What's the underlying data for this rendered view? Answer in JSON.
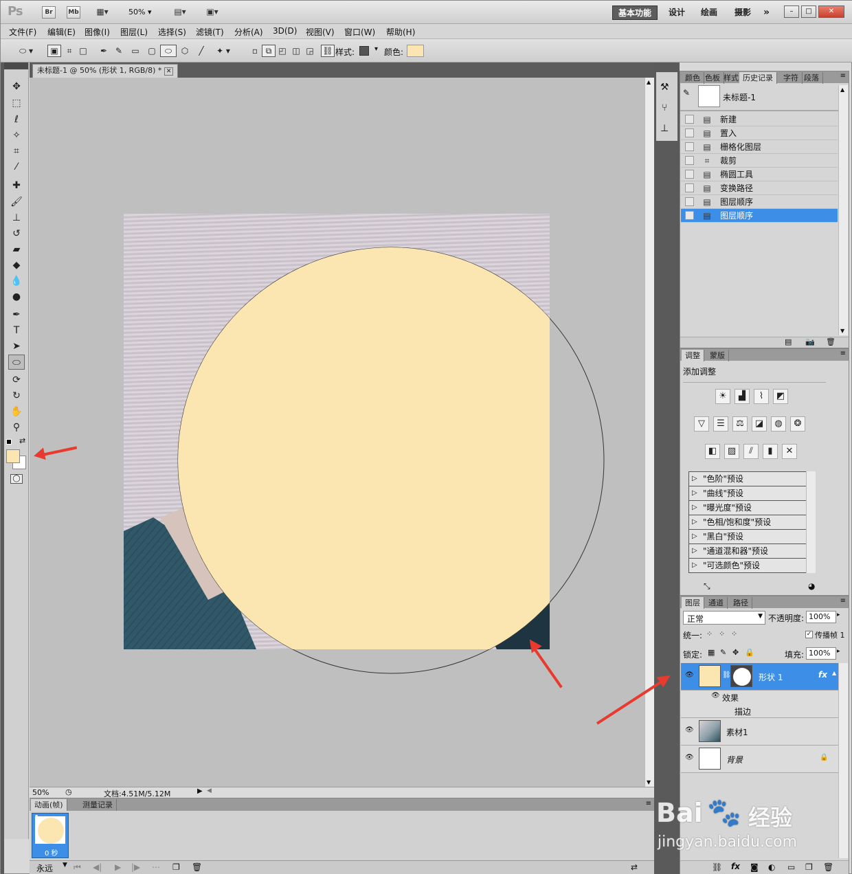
{
  "app": {
    "logo": "Ps",
    "zoom_select": "50%"
  },
  "appbar": {
    "br": "Br",
    "mb": "Mb",
    "workspaces": [
      "基本功能",
      "设计",
      "绘画",
      "摄影"
    ],
    "more": "»"
  },
  "menubar": {
    "items": [
      "文件(F)",
      "编辑(E)",
      "图像(I)",
      "图层(L)",
      "选择(S)",
      "滤镜(T)",
      "分析(A)",
      "3D(D)",
      "视图(V)",
      "窗口(W)",
      "帮助(H)"
    ]
  },
  "options": {
    "style_label": "样式:",
    "color_label": "颜色:",
    "color": "#fbe5b1"
  },
  "document": {
    "tab_title": "未标题-1 @ 50% (形状 1, RGB/8) *",
    "shape_fill": "#fbe5b1",
    "zoom": "50%",
    "doc_info": "文档:4.51M/5.12M"
  },
  "tools": {
    "fg_color": "#fbe5b1",
    "bg_color": "#ffffff"
  },
  "animation": {
    "tabs": [
      "动画(帧)",
      "测量记录"
    ],
    "frame_number": "1",
    "frame_delay": "0 秒",
    "loop": "永远"
  },
  "history": {
    "tabs": [
      "颜色",
      "色板",
      "样式",
      "历史记录",
      "字符",
      "段落"
    ],
    "snapshot": "未标题-1",
    "items": [
      "新建",
      "置入",
      "栅格化图层",
      "裁剪",
      "椭圆工具",
      "变换路径",
      "图层顺序",
      "图层顺序"
    ],
    "selected_index": 7
  },
  "adjustments": {
    "tabs": [
      "调整",
      "蒙版"
    ],
    "title": "添加调整",
    "presets": [
      "\"色阶\"预设",
      "\"曲线\"预设",
      "\"曝光度\"预设",
      "\"色相/饱和度\"预设",
      "\"黑白\"预设",
      "\"通道混和器\"预设",
      "\"可选颜色\"预设"
    ]
  },
  "layers": {
    "tabs": [
      "图层",
      "通道",
      "路径"
    ],
    "blend_mode": "正常",
    "opacity_label": "不透明度:",
    "opacity": "100%",
    "unify_label": "统一:",
    "propagate_label": "传播帧 1",
    "lock_label": "锁定:",
    "fill_label": "填充:",
    "fill": "100%",
    "shape_layer": "形状 1",
    "effects_label": "效果",
    "stroke_label": "描边",
    "layer2": "素材1",
    "background": "背景"
  },
  "watermark": {
    "brand": "Bai",
    "brand2": "经验",
    "url": "jingyan.baidu.com"
  }
}
